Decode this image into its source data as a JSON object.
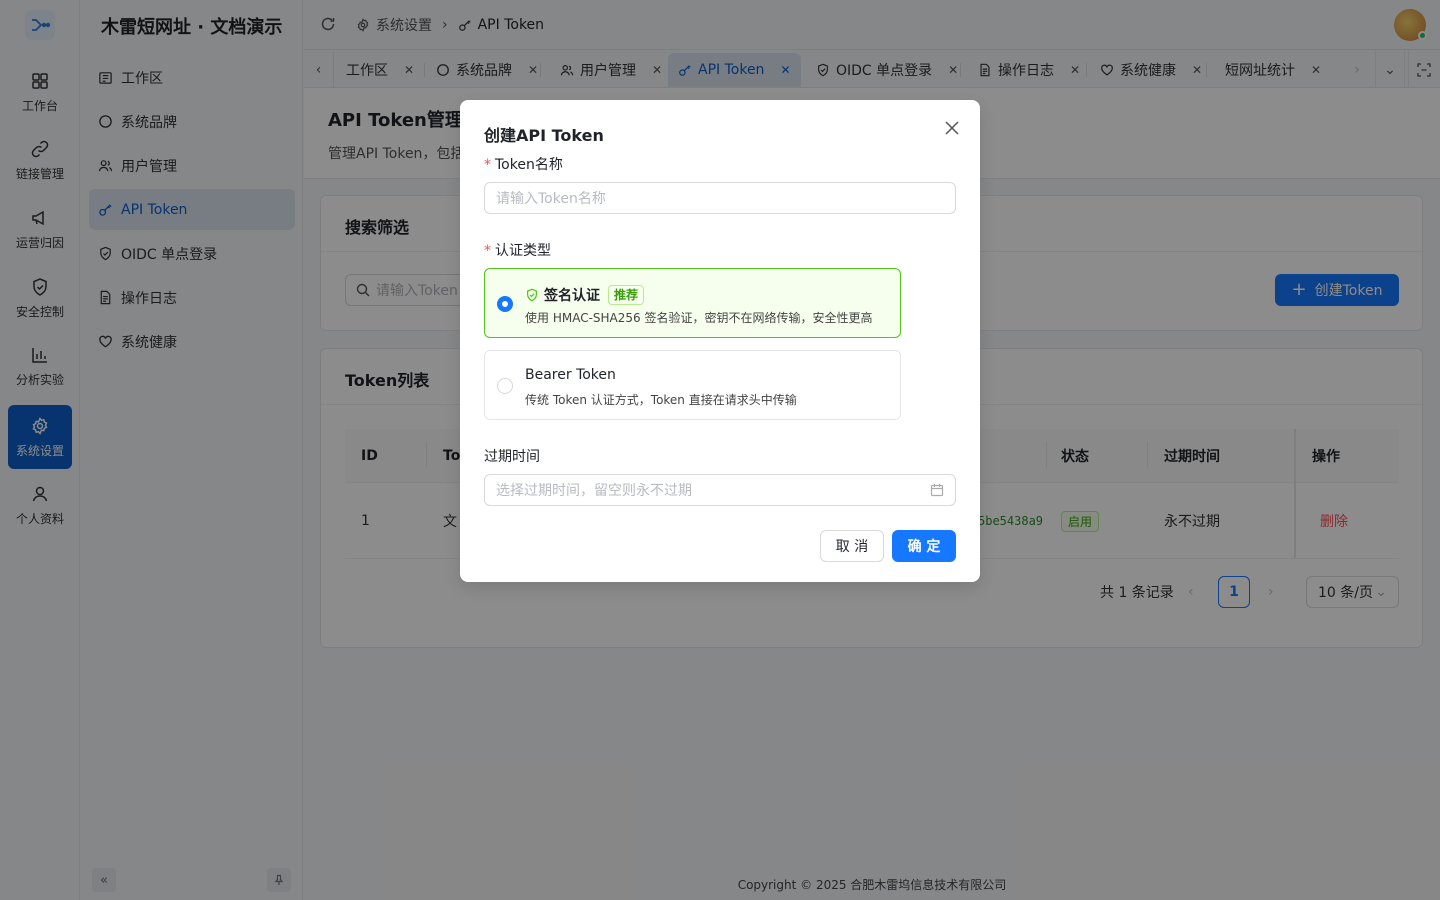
{
  "brand": "木雷短网址 · 文档演示",
  "rail": [
    {
      "label": "工作台",
      "icon": "dashboard-icon"
    },
    {
      "label": "链接管理",
      "icon": "link-icon"
    },
    {
      "label": "运营归因",
      "icon": "megaphone-icon"
    },
    {
      "label": "安全控制",
      "icon": "shield-icon"
    },
    {
      "label": "分析实验",
      "icon": "bar-chart-icon"
    },
    {
      "label": "系统设置",
      "icon": "gear-icon"
    },
    {
      "label": "个人资料",
      "icon": "user-icon"
    }
  ],
  "sidebar": {
    "items": [
      {
        "label": "工作区",
        "icon": "workspace-icon"
      },
      {
        "label": "系统品牌",
        "icon": "circle-icon"
      },
      {
        "label": "用户管理",
        "icon": "users-icon"
      },
      {
        "label": "API Token",
        "icon": "key-icon"
      },
      {
        "label": "OIDC 单点登录",
        "icon": "shield-check-icon"
      },
      {
        "label": "操作日志",
        "icon": "document-icon"
      },
      {
        "label": "系统健康",
        "icon": "heart-icon"
      }
    ]
  },
  "breadcrumb": {
    "parent": "系统设置",
    "current": "API Token"
  },
  "tabs": [
    {
      "label": "工作区"
    },
    {
      "label": "系统品牌"
    },
    {
      "label": "用户管理"
    },
    {
      "label": "API Token"
    },
    {
      "label": "OIDC 单点登录"
    },
    {
      "label": "操作日志"
    },
    {
      "label": "系统健康"
    },
    {
      "label": "短网址统计"
    }
  ],
  "page": {
    "title": "API Token管理",
    "desc": "管理API Token，包括"
  },
  "search_card": {
    "title": "搜索筛选",
    "placeholder": "请输入Token",
    "create_label": "创建Token"
  },
  "table": {
    "title": "Token列表",
    "headers": {
      "id": "ID",
      "name": "To",
      "status": "状态",
      "expire": "过期时间",
      "action": "操作"
    },
    "rows": [
      {
        "id": "1",
        "name": "文",
        "token": "5be5438a9",
        "status": "启用",
        "expire": "永不过期",
        "action": "删除"
      }
    ]
  },
  "pagination": {
    "total": "共 1 条记录",
    "current": "1",
    "page_size": "10 条/页"
  },
  "footer": "Copyright © 2025 合肥木雷坞信息技术有限公司",
  "modal": {
    "title": "创建API Token",
    "name_label": "Token名称",
    "name_placeholder": "请输入Token名称",
    "auth_label": "认证类型",
    "options": [
      {
        "title": "签名认证",
        "badge": "推荐",
        "desc": "使用 HMAC-SHA256 签名验证，密钥不在网络传输，安全性更高"
      },
      {
        "title": "Bearer Token",
        "desc": "传统 Token 认证方式，Token 直接在请求头中传输"
      }
    ],
    "expire_label": "过期时间",
    "expire_placeholder": "选择过期时间，留空则永不过期",
    "cancel": "取 消",
    "ok": "确 定"
  }
}
